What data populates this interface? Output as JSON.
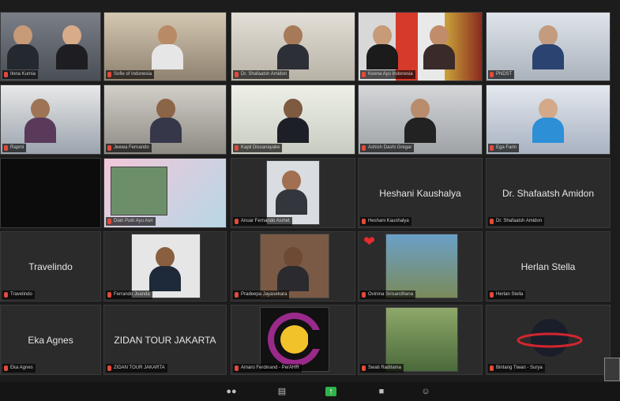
{
  "tiles": [
    {
      "label": "Ilona Kurnia"
    },
    {
      "label": "Sofie of Indonesia"
    },
    {
      "label": "Dr. Shafaatsh Amidon"
    },
    {
      "label": "Keena Ayu Indonesia"
    },
    {
      "label": "PNDST"
    },
    {
      "label": "Rapmi"
    },
    {
      "label": "Jeewa Fernando"
    },
    {
      "label": "Kapil Dissanayake"
    },
    {
      "label": "Ashish Dashi Gregar"
    },
    {
      "label": "Ega Farin"
    },
    {
      "label": "Diah Putri Ayu Asri"
    },
    {
      "label": "Anuar Fernando Asmet"
    },
    {
      "label": "Heshani Kaushalya",
      "center": "Heshani Kaushalya"
    },
    {
      "label": "Dr. Shafaatsh Amidon",
      "center": "Dr. Shafaatsh Amidon"
    },
    {
      "label": "Travelindo",
      "center": "Travelindo"
    },
    {
      "label": "Ferrando Juanda"
    },
    {
      "label": "Pradeepa Jayasekara"
    },
    {
      "label": "Ovinina Sirisandhana"
    },
    {
      "label": "Herlan Stella",
      "center": "Herlan Stella"
    },
    {
      "label": "Eka Agnes",
      "center": "Eka Agnes"
    },
    {
      "label": "ZIDAN TOUR JAKARTA",
      "center": "ZIDAN TOUR JAKARTA"
    },
    {
      "label": "Amaro Ferdinand - PerAHR"
    },
    {
      "label": "Swati Raditama"
    },
    {
      "label": "Bintang Tiwari - Surya"
    }
  ],
  "toolbar": {
    "participants_icon": "participants-icon",
    "chat_icon": "chat-icon",
    "share_icon": "share-screen-icon",
    "record_icon": "record-icon",
    "reactions_icon": "reactions-icon"
  },
  "colors": {
    "mic_muted": "#e24a3b",
    "heart": "#e52b2b",
    "share_green": "#2fb34a"
  }
}
